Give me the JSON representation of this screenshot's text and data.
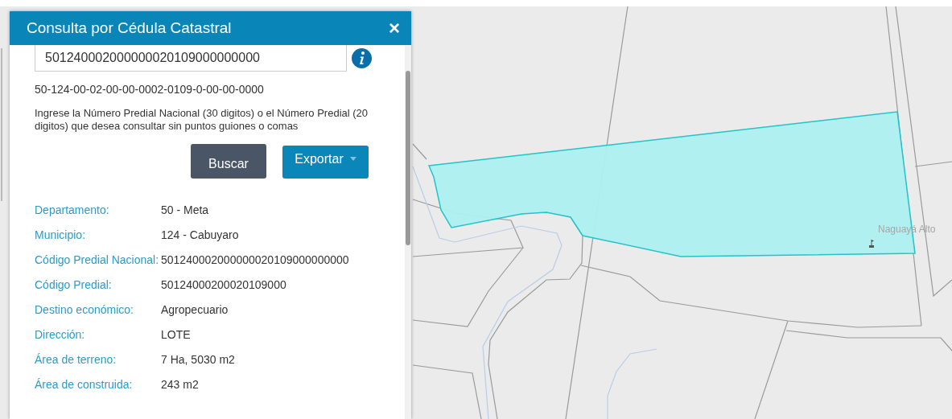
{
  "map": {
    "place_label": "Naguayá Alto"
  },
  "panel": {
    "title": "Consulta por Cédula Catastral",
    "close_icon": "×",
    "search": {
      "value": "501240002000000020109000000000"
    },
    "formatted_code": "50-124-00-02-00-00-0002-0109-0-00-00-0000",
    "instructions": "Ingrese la Número Predial Nacional (30 digitos) o el Número Predial (20 digitos) que desea consultar sin puntos guiones o comas",
    "buttons": [
      {
        "label": "Buscar",
        "kind": "plain"
      },
      {
        "label": "Exportar",
        "kind": "dropdown"
      }
    ],
    "attributes": [
      {
        "label": "Departamento:",
        "value": "50 - Meta"
      },
      {
        "label": "Municipio:",
        "value": "124 - Cabuyaro"
      },
      {
        "label": "Código Predial Nacional:",
        "value": "501240002000000020109000000000"
      },
      {
        "label": "Código Predial:",
        "value": "50124000200020109000"
      },
      {
        "label": "Destino económico:",
        "value": "Agropecuario"
      },
      {
        "label": "Dirección:",
        "value": "LOTE"
      },
      {
        "label": "Área de terreno:",
        "value": "7 Ha, 5030 m2"
      },
      {
        "label": "Área de construida:",
        "value": "243 m2"
      }
    ]
  }
}
